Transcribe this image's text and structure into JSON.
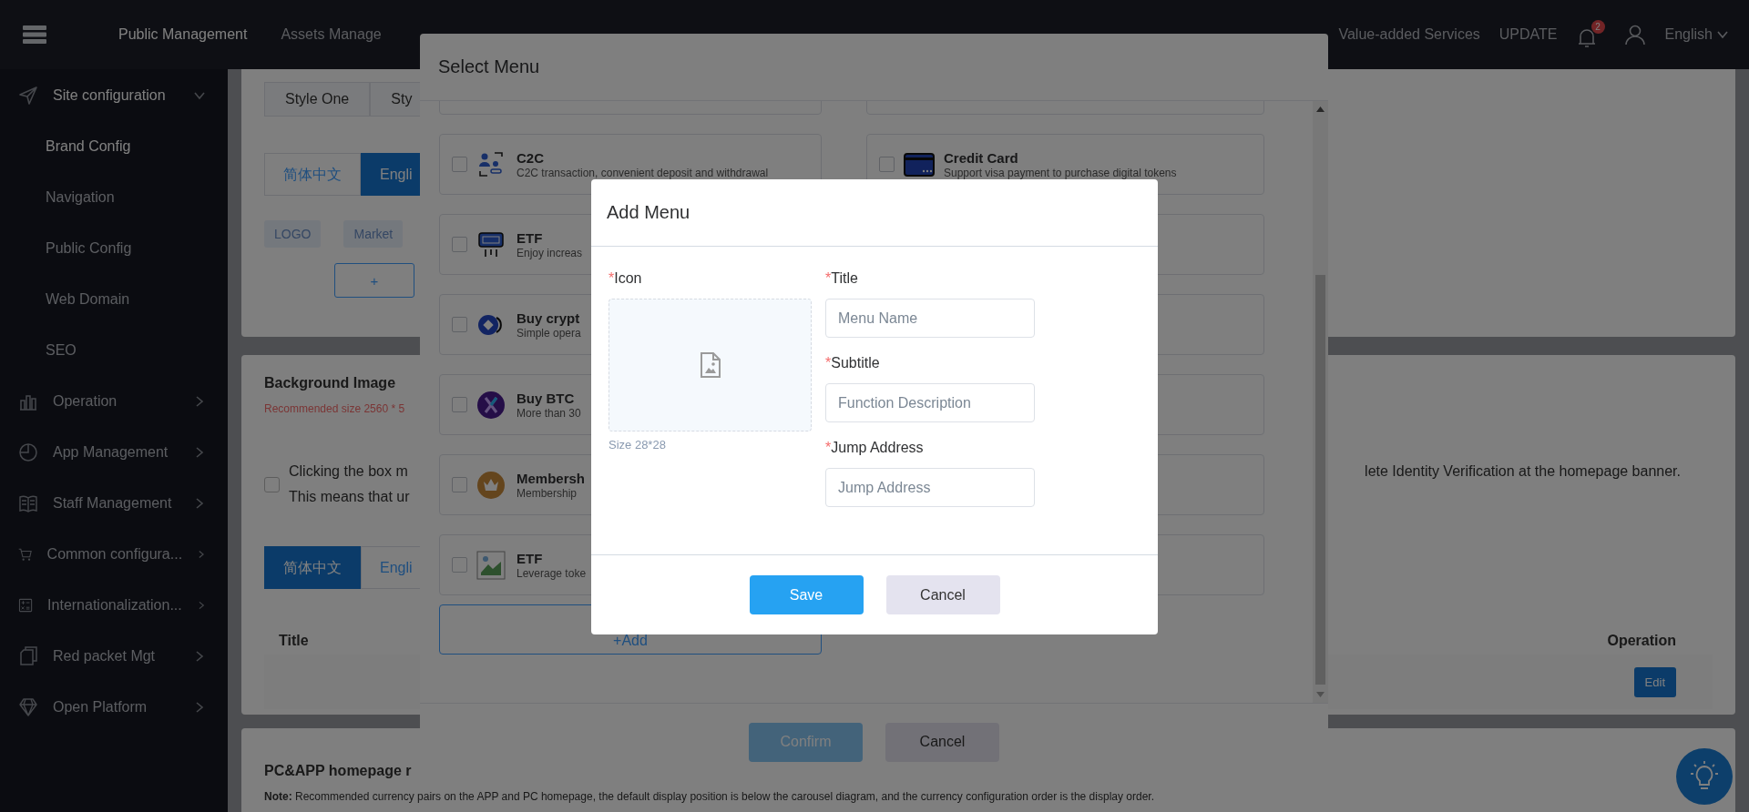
{
  "top_nav": {
    "items": [
      {
        "label": "Public Management",
        "selected": true
      },
      {
        "label": "Assets Manage",
        "selected": false
      }
    ],
    "services": "Value-added Services",
    "update": "UPDATE",
    "notification_count": "2",
    "language": "English"
  },
  "sidebar": {
    "items": [
      {
        "label": "Site configuration",
        "expanded": true,
        "children": [
          {
            "label": "Brand Config",
            "selected": true
          },
          {
            "label": "Navigation",
            "selected": false
          },
          {
            "label": "Public Config",
            "selected": false
          },
          {
            "label": "Web Domain",
            "selected": false
          },
          {
            "label": "SEO",
            "selected": false
          }
        ]
      },
      {
        "label": "Operation",
        "expanded": false
      },
      {
        "label": "App Management",
        "expanded": false
      },
      {
        "label": "Staff Management",
        "expanded": false
      },
      {
        "label": "Common configura...",
        "expanded": false
      },
      {
        "label": "Internationalization...",
        "expanded": false
      },
      {
        "label": "Red packet Mgt",
        "expanded": false
      },
      {
        "label": "Open Platform",
        "expanded": false
      }
    ]
  },
  "brand_panel": {
    "style_tabs": [
      "Style One",
      "Sty"
    ],
    "language_tabs": [
      {
        "label": "简体中文",
        "selected": false
      },
      {
        "label": "Engli",
        "selected": true
      }
    ],
    "chips": [
      "LOGO",
      "Market"
    ],
    "add_button": "+"
  },
  "background_panel": {
    "title": "Background Image",
    "hint": "Recommended size 2560 * 5",
    "notice": {
      "checked": false,
      "lines": [
        "Clicking the box m",
        "This means that ur"
      ],
      "line_1_end": "lete Identity Verification at the homepage banner."
    },
    "language_tabs": [
      {
        "label": "简体中文",
        "selected": true
      },
      {
        "label": "Engli",
        "selected": false
      }
    ],
    "table": {
      "columns": [
        "Title",
        "Operation"
      ],
      "rows": [
        {
          "action": "Edit"
        }
      ]
    }
  },
  "homepage_panel": {
    "title": "PC&APP homepage r",
    "note": "**Note:** Recommended currency pairs on the APP and PC homepage, the default display position is below the carousel diagram, and the currency configuration order is the display order."
  },
  "select_menu": {
    "title": "Select Menu",
    "rows": [
      {
        "left": {
          "title": "C2C",
          "subtitle": "C2C transaction, convenient deposit and withdrawal",
          "checked": false
        },
        "right": {
          "title": "Credit Card",
          "subtitle": "Support visa payment to purchase digital tokens",
          "checked": false
        }
      },
      {
        "left": {
          "title": "ETF",
          "subtitle": "Enjoy increas",
          "checked": false
        }
      },
      {
        "left": {
          "title": "Buy crypt",
          "subtitle": "Simple opera",
          "checked": false
        }
      },
      {
        "left": {
          "title": "Buy BTC",
          "subtitle": "More than 30",
          "checked": false
        }
      },
      {
        "left": {
          "title": "Membersh",
          "subtitle": "Membership",
          "checked": false
        }
      },
      {
        "left": {
          "title": "ETF",
          "subtitle": "Leverage toke",
          "checked": false
        }
      }
    ],
    "add_button": "+Add",
    "buttons": [
      {
        "label": "Confirm",
        "kind": "primary"
      },
      {
        "label": "Cancel",
        "kind": "secondary"
      }
    ]
  },
  "add_menu": {
    "title": "Add Menu",
    "icon_field": {
      "required_mark": "*",
      "label": "Icon",
      "hint": "Size 28*28"
    },
    "fields": [
      {
        "required_mark": "*",
        "label": "Title",
        "placeholder": "Menu Name"
      },
      {
        "required_mark": "*",
        "label": "Subtitle",
        "placeholder": "Function Description"
      },
      {
        "required_mark": "*",
        "label": "Jump Address",
        "placeholder": "Jump Address"
      }
    ],
    "buttons": [
      {
        "label": "Save",
        "kind": "primary"
      },
      {
        "label": "Cancel",
        "kind": "secondary"
      }
    ]
  }
}
